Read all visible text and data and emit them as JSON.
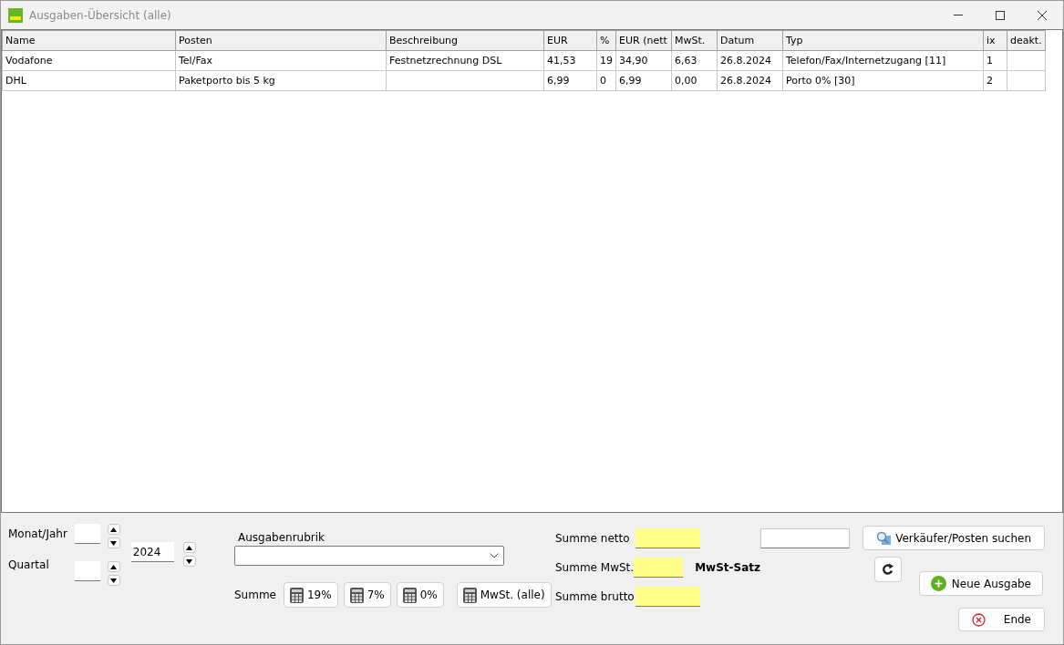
{
  "window": {
    "title": "Ausgaben-Übersicht (alle)"
  },
  "table": {
    "columns": [
      "Name",
      "Posten",
      "Beschreibung",
      "EUR",
      "%",
      "EUR (nett",
      "MwSt.",
      "Datum",
      "Typ",
      "ix",
      "deakt."
    ],
    "rows": [
      [
        "Vodafone",
        "Tel/Fax",
        "Festnetzrechnung DSL",
        "41,53",
        "19",
        "34,90",
        "6,63",
        "26.8.2024",
        "Telefon/Fax/Internetzugang [11]",
        "1",
        ""
      ],
      [
        "DHL",
        "Paketporto bis 5 kg",
        "",
        "6,99",
        "0",
        "6,99",
        "0,00",
        "26.8.2024",
        "Porto 0% [30]",
        "2",
        ""
      ]
    ]
  },
  "period": {
    "month_label": "Monat/Jahr",
    "quarter_label": "Quartal",
    "year": "2024"
  },
  "category": {
    "label": "Ausgabenrubrik"
  },
  "sum_buttons": {
    "label": "Summe",
    "buttons": [
      "19%",
      "7%",
      "0%",
      "MwSt. (alle)"
    ]
  },
  "totals": [
    {
      "label": "Summe netto"
    },
    {
      "label": "Summe MwSt."
    },
    {
      "label": "Summe brutto"
    }
  ],
  "vat_rate_label": "MwSt-Satz",
  "actions": {
    "search": "Verkäufer/Posten suchen",
    "new": "Neue Ausgabe",
    "end": "Ende"
  }
}
